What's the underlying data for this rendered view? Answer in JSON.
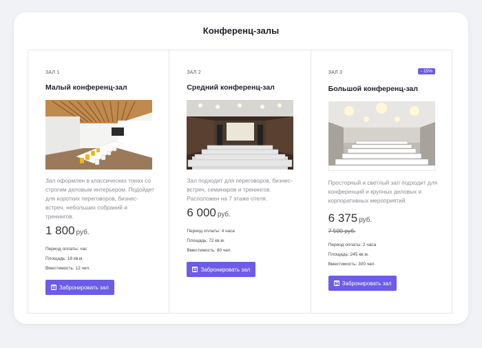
{
  "page": {
    "title": "Конференц-залы"
  },
  "halls": [
    {
      "label": "ЗАЛ 1",
      "name": "Малый конференц-зал",
      "description": "Зал оформлен в классических тонах со строгим деловым интерьером. Подойдет для коротких переговоров, бизнес-встреч, небольших собраний и тренингов.",
      "price": "1 800",
      "currency": "руб.",
      "period": "Период оплаты: час",
      "area": "Площадь: 18 кв.м.",
      "capacity": "Вместимость: 12 чел.",
      "button": "Забронировать зал",
      "icon": "calendar-icon"
    },
    {
      "label": "ЗАЛ 2",
      "name": "Средний конференц-зал",
      "description": "Зал подходит для переговоров, бизнес-встреч, семинаров и тренингов. Расположен на 7 этаже отеля.",
      "price": "6 000",
      "currency": "руб.",
      "period": "Период оплаты: 4 часа",
      "area": "Площадь: 72 кв.м.",
      "capacity": "Вместимость: 80 чел.",
      "button": "Забронировать зал",
      "icon": "calendar-icon"
    },
    {
      "label": "ЗАЛ 3",
      "badge": "- 15%",
      "name": "Большой конференц-зал",
      "description": "Просторный и светлый зал подходит для конференций и крупных деловых и корпоративных мероприятий.",
      "price": "6 375",
      "currency": "руб.",
      "old_price": "7 500 руб.",
      "period": "Период оплаты: 2 часа",
      "area": "Площадь: 245 кв.м.",
      "capacity": "Вместимость: 300 чел.",
      "button": "Забронировать зал",
      "icon": "calendar-icon"
    }
  ],
  "colors": {
    "accent": "#6c5ce7",
    "background": "#f1f2f6",
    "card": "#ffffff"
  }
}
